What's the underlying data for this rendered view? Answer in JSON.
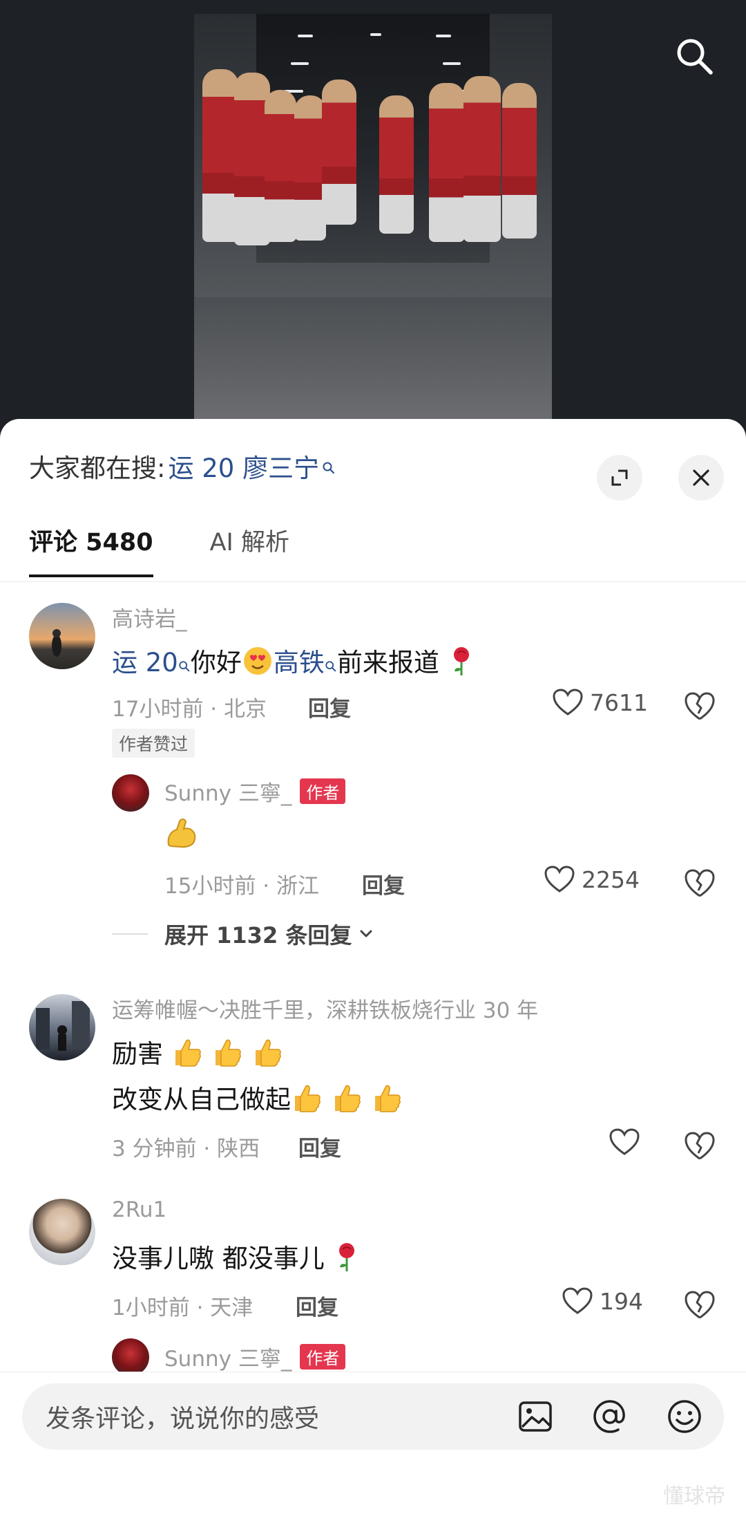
{
  "header": {
    "search_icon": "search-icon"
  },
  "sheet": {
    "search_prefix": "大家都在搜:",
    "search_term": "运 20 廖三宁",
    "tabs": [
      {
        "label": "评论 5480",
        "active": true
      },
      {
        "label": "AI 解析",
        "active": false
      }
    ]
  },
  "comments": [
    {
      "user": "高诗岩_",
      "text_parts": [
        "运 20",
        "你好",
        "高铁",
        "前来报道"
      ],
      "time_loc": "17小时前 · 北京",
      "reply_label": "回复",
      "likes": "7611",
      "author_liked": "作者赞过",
      "reply": {
        "user": "Sunny 三寧_",
        "badge": "作者",
        "text": "💪",
        "time_loc": "15小时前 · 浙江",
        "reply_label": "回复",
        "likes": "2254"
      },
      "expand_label": "展开 1132 条回复"
    },
    {
      "user": "运筹帷幄～决胜千里，深耕铁板烧行业 30 年",
      "line1": "励害",
      "line2": "改变从自己做起",
      "time_loc": "3 分钟前 · 陕西",
      "reply_label": "回复",
      "likes": ""
    },
    {
      "user": "2Ru1",
      "text": "没事儿嗷 都没事儿",
      "time_loc": "1小时前 · 天津",
      "reply_label": "回复",
      "likes": "194",
      "reply_preview": {
        "user": "Sunny 三寧_",
        "badge": "作者"
      }
    }
  ],
  "input": {
    "placeholder": "发条评论，说说你的感受"
  },
  "watermark": "懂球帝",
  "colors": {
    "keyword_blue": "#2b4f8c",
    "author_badge": "#e4364f",
    "video_bg": "#1e2125"
  }
}
